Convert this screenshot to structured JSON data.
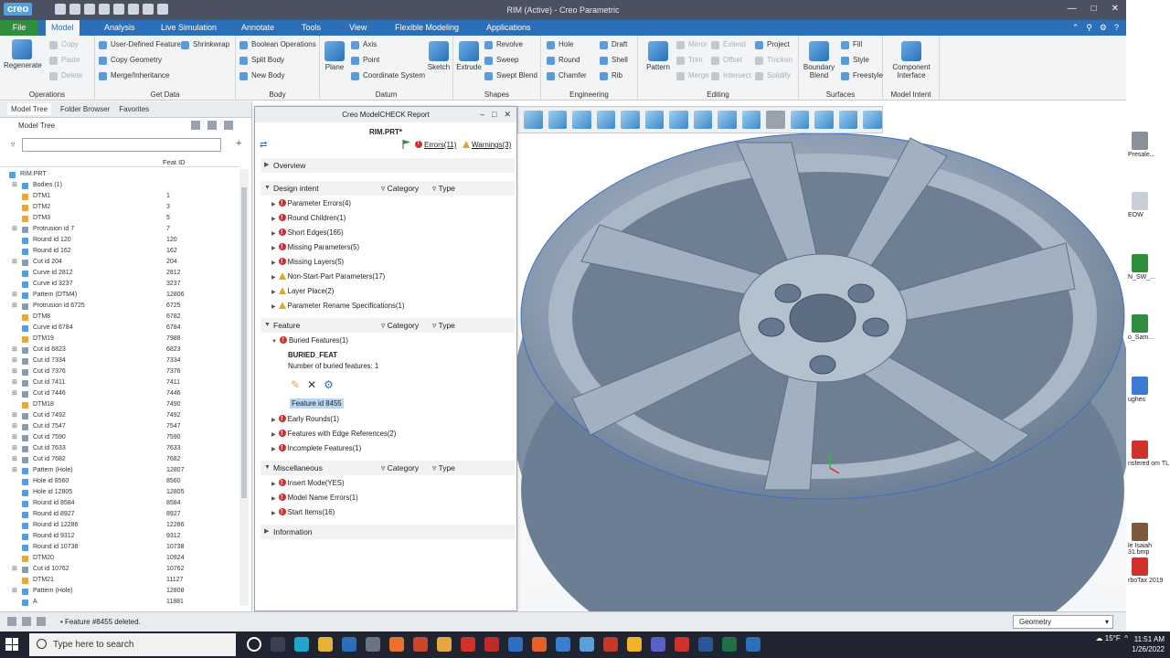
{
  "app": {
    "logo": "creo",
    "title": "RIM (Active) - Creo Parametric"
  },
  "ribbon_tabs": [
    {
      "label": "File"
    },
    {
      "label": "Model",
      "active": true
    },
    {
      "label": "Analysis"
    },
    {
      "label": "Live Simulation"
    },
    {
      "label": "Annotate"
    },
    {
      "label": "Tools"
    },
    {
      "label": "View"
    },
    {
      "label": "Flexible Modeling"
    },
    {
      "label": "Applications"
    }
  ],
  "ribbon": {
    "operations": {
      "label": "Operations",
      "regenerate": "Regenerate",
      "copy": "Copy",
      "paste": "Paste",
      "delete": "Delete"
    },
    "get_data": {
      "label": "Get Data",
      "udf": "User-Defined Feature",
      "copy_geometry": "Copy Geometry",
      "shrinkwrap": "Shrinkwrap",
      "merge": "Merge/Inheritance"
    },
    "body": {
      "label": "Body",
      "boolean": "Boolean Operations",
      "split": "Split Body",
      "new": "New Body"
    },
    "datum": {
      "label": "Datum",
      "plane": "Plane",
      "axis": "Axis",
      "point": "Point",
      "csys": "Coordinate System",
      "sketch": "Sketch"
    },
    "shapes": {
      "label": "Shapes",
      "extrude": "Extrude",
      "revolve": "Revolve",
      "sweep": "Sweep",
      "swept_blend": "Swept Blend"
    },
    "engineering": {
      "label": "Engineering",
      "hole": "Hole",
      "round": "Round",
      "chamfer": "Chamfer",
      "draft": "Draft",
      "shell": "Shell",
      "rib": "Rib"
    },
    "editing": {
      "label": "Editing",
      "pattern": "Pattern",
      "mirror": "Mirror",
      "trim": "Trim",
      "merge": "Merge",
      "extend": "Extend",
      "offset": "Offset",
      "intersect": "Intersect",
      "project": "Project",
      "thicken": "Thicken",
      "solidify": "Solidify"
    },
    "surfaces": {
      "label": "Surfaces",
      "boundary": "Boundary Blend",
      "fill": "Fill",
      "style": "Style",
      "freestyle": "Freestyle"
    },
    "model_intent": {
      "label": "Model Intent",
      "component": "Component Interface"
    }
  },
  "left_panel": {
    "tabs": [
      "Model Tree",
      "Folder Browser",
      "Favorites"
    ],
    "header": "Model Tree",
    "column": "Feat ID",
    "rows": [
      {
        "name": "RIM.PRT",
        "id": "",
        "indent": 0,
        "expand": false,
        "color": "#5a9bd8"
      },
      {
        "name": "Bodies (1)",
        "id": "",
        "indent": 1,
        "expand": true,
        "color": "#5a9bd8"
      },
      {
        "name": "DTM1",
        "id": "1",
        "indent": 1,
        "expand": false,
        "color": "#e6a640"
      },
      {
        "name": "DTM2",
        "id": "3",
        "indent": 1,
        "expand": false,
        "color": "#e6a640"
      },
      {
        "name": "DTM3",
        "id": "5",
        "indent": 1,
        "expand": false,
        "color": "#e6a640"
      },
      {
        "name": "Protrusion id 7",
        "id": "7",
        "indent": 1,
        "expand": true,
        "color": "#8a9bb0"
      },
      {
        "name": "Round id 120",
        "id": "120",
        "indent": 1,
        "expand": false,
        "color": "#5a9bd8"
      },
      {
        "name": "Round id 162",
        "id": "162",
        "indent": 1,
        "expand": false,
        "color": "#5a9bd8"
      },
      {
        "name": "Cut id 204",
        "id": "204",
        "indent": 1,
        "expand": true,
        "color": "#8a9bb0"
      },
      {
        "name": "Curve id 2812",
        "id": "2812",
        "indent": 1,
        "expand": false,
        "color": "#5a9bd8"
      },
      {
        "name": "Curve id 3237",
        "id": "3237",
        "indent": 1,
        "expand": false,
        "color": "#5a9bd8"
      },
      {
        "name": "Pattern (DTM4)",
        "id": "12806",
        "indent": 1,
        "expand": true,
        "color": "#5a9bd8"
      },
      {
        "name": "Protrusion id 6725",
        "id": "6725",
        "indent": 1,
        "expand": true,
        "color": "#8a9bb0"
      },
      {
        "name": "DTM8",
        "id": "6782",
        "indent": 1,
        "expand": false,
        "color": "#e6a640"
      },
      {
        "name": "Curve id 6784",
        "id": "6784",
        "indent": 1,
        "expand": false,
        "color": "#5a9bd8"
      },
      {
        "name": "DTM19",
        "id": "7988",
        "indent": 1,
        "expand": false,
        "color": "#e6a640"
      },
      {
        "name": "Cut id 6823",
        "id": "6823",
        "indent": 1,
        "expand": true,
        "color": "#8a9bb0"
      },
      {
        "name": "Cut id 7334",
        "id": "7334",
        "indent": 1,
        "expand": true,
        "color": "#8a9bb0"
      },
      {
        "name": "Cut id 7376",
        "id": "7376",
        "indent": 1,
        "expand": true,
        "color": "#8a9bb0"
      },
      {
        "name": "Cut id 7411",
        "id": "7411",
        "indent": 1,
        "expand": true,
        "color": "#8a9bb0"
      },
      {
        "name": "Cut id 7446",
        "id": "7446",
        "indent": 1,
        "expand": true,
        "color": "#8a9bb0"
      },
      {
        "name": "DTM18",
        "id": "7490",
        "indent": 1,
        "expand": false,
        "color": "#e6a640"
      },
      {
        "name": "Cut id 7492",
        "id": "7492",
        "indent": 1,
        "expand": true,
        "color": "#8a9bb0"
      },
      {
        "name": "Cut id 7547",
        "id": "7547",
        "indent": 1,
        "expand": true,
        "color": "#8a9bb0"
      },
      {
        "name": "Cut id 7590",
        "id": "7590",
        "indent": 1,
        "expand": true,
        "color": "#8a9bb0"
      },
      {
        "name": "Cut id 7633",
        "id": "7633",
        "indent": 1,
        "expand": true,
        "color": "#8a9bb0"
      },
      {
        "name": "Cut id 7682",
        "id": "7682",
        "indent": 1,
        "expand": true,
        "color": "#8a9bb0"
      },
      {
        "name": "Pattern (Hole)",
        "id": "12807",
        "indent": 1,
        "expand": true,
        "color": "#5a9bd8"
      },
      {
        "name": "Hole id 8560",
        "id": "8560",
        "indent": 1,
        "expand": false,
        "color": "#5a9bd8"
      },
      {
        "name": "Hole id 12805",
        "id": "12805",
        "indent": 1,
        "expand": false,
        "color": "#5a9bd8"
      },
      {
        "name": "Round id 8584",
        "id": "8584",
        "indent": 1,
        "expand": false,
        "color": "#5a9bd8"
      },
      {
        "name": "Round id 8927",
        "id": "8927",
        "indent": 1,
        "expand": false,
        "color": "#5a9bd8"
      },
      {
        "name": "Round id 12286",
        "id": "12286",
        "indent": 1,
        "expand": false,
        "color": "#5a9bd8"
      },
      {
        "name": "Round id 9312",
        "id": "9312",
        "indent": 1,
        "expand": false,
        "color": "#5a9bd8"
      },
      {
        "name": "Round id 10738",
        "id": "10738",
        "indent": 1,
        "expand": false,
        "color": "#5a9bd8"
      },
      {
        "name": "DTM20",
        "id": "10924",
        "indent": 1,
        "expand": false,
        "color": "#e6a640"
      },
      {
        "name": "Cut id 10762",
        "id": "10762",
        "indent": 1,
        "expand": true,
        "color": "#8a9bb0"
      },
      {
        "name": "DTM21",
        "id": "11127",
        "indent": 1,
        "expand": false,
        "color": "#e6a640"
      },
      {
        "name": "Pattern (Hole)",
        "id": "12808",
        "indent": 1,
        "expand": true,
        "color": "#5a9bd8"
      },
      {
        "name": "A",
        "id": "11881",
        "indent": 1,
        "expand": false,
        "color": "#5a9bd8"
      }
    ]
  },
  "dialog": {
    "title": "Creo ModelCHECK Report",
    "file": "RIM.PRT*",
    "errors": "Errors(11)",
    "warnings": "Warnings(3)",
    "category": "Category",
    "type": "Type",
    "overview": "Overview",
    "design_intent": "Design intent",
    "design_items": [
      {
        "label": "Parameter Errors(4)",
        "level": "error"
      },
      {
        "label": "Round Children(1)",
        "level": "error"
      },
      {
        "label": "Short Edges(165)",
        "level": "error"
      },
      {
        "label": "Missing Parameters(5)",
        "level": "error"
      },
      {
        "label": "Missing Layers(5)",
        "level": "error"
      },
      {
        "label": "Non-Start-Part Parameters(17)",
        "level": "warning"
      },
      {
        "label": "Layer Place(2)",
        "level": "warning"
      },
      {
        "label": "Parameter Rename Specifications(1)",
        "level": "warning"
      }
    ],
    "feature": "Feature",
    "buried": "Buried Features(1)",
    "buried_name": "BURIED_FEAT",
    "buried_count": "Number of buried features: 1",
    "feature_id": "Feature id 8455",
    "feature_items": [
      {
        "label": "Early Rounds(1)",
        "level": "error"
      },
      {
        "label": "Features with Edge References(2)",
        "level": "error"
      },
      {
        "label": "Incomplete Features(1)",
        "level": "error"
      }
    ],
    "misc": "Miscellaneous",
    "misc_items": [
      {
        "label": "Insert Mode(YES)",
        "level": "error"
      },
      {
        "label": "Model Name Errors(1)",
        "level": "error"
      },
      {
        "label": "Start Items(16)",
        "level": "error"
      }
    ],
    "information": "Information"
  },
  "status": {
    "message": "Feature #8455 deleted.",
    "filter": "Geometry"
  },
  "desktop_icons": [
    {
      "label": "Presale...",
      "color": "#8a8f99"
    },
    {
      "label": "EOW",
      "color": "#c9cfd8"
    },
    {
      "label": "N_SW_...",
      "color": "#2e8e3e"
    },
    {
      "label": "o_Sam...",
      "color": "#2e8e3e"
    },
    {
      "label": "ughes",
      "color": "#3b7bd0"
    },
    {
      "label": "nsfered om TL",
      "color": "#d0312d"
    },
    {
      "label": "le Isaiah 31.bmp",
      "color": "#7a5a3a"
    },
    {
      "label": "rboTax 2019",
      "color": "#d0312d"
    }
  ],
  "taskbar": {
    "search": "Type here to search",
    "temp": "15°F",
    "time": "11:51 AM",
    "date": "1/26/2022"
  }
}
